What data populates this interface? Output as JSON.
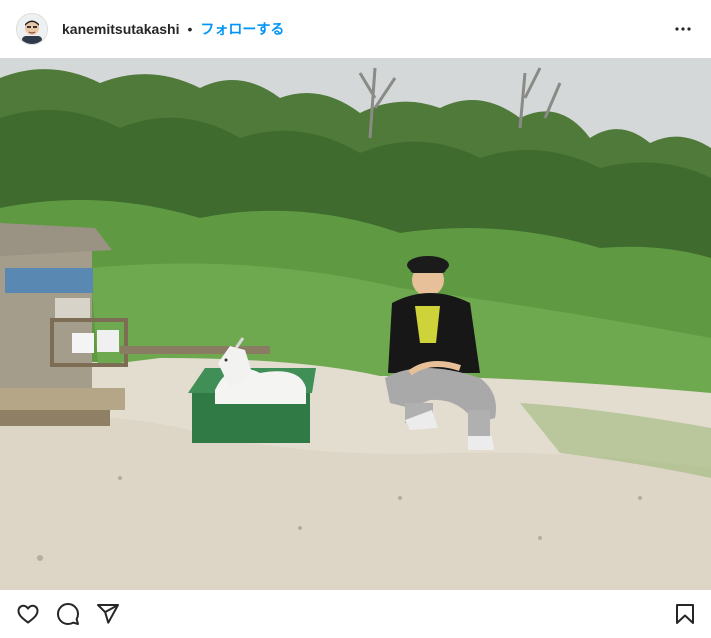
{
  "post": {
    "username": "kanemitsutakashi",
    "separator": "•",
    "follow_label": "フォローする"
  },
  "icons": {
    "avatar": "profile-avatar",
    "more": "more-options-icon",
    "like": "heart-icon",
    "comment": "comment-bubble-icon",
    "share": "paper-plane-icon",
    "save": "bookmark-icon"
  },
  "colors": {
    "follow_link": "#0095f6",
    "text": "#262626"
  }
}
